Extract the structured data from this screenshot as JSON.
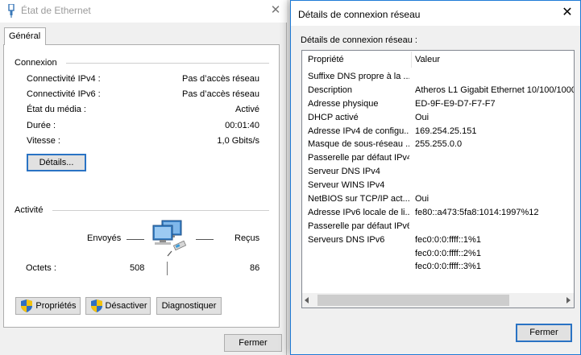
{
  "etat_window": {
    "title": "État de Ethernet",
    "tab": "Général",
    "connexion": {
      "title": "Connexion",
      "rows": [
        {
          "label": "Connectivité IPv4 :",
          "value": "Pas d’accès réseau"
        },
        {
          "label": "Connectivité IPv6 :",
          "value": "Pas d’accès réseau"
        },
        {
          "label": "État du média :",
          "value": "Activé"
        },
        {
          "label": "Durée :",
          "value": "00:01:40"
        },
        {
          "label": "Vitesse :",
          "value": "1,0 Gbits/s"
        }
      ],
      "details_button": "Détails..."
    },
    "activite": {
      "title": "Activité",
      "sent_label": "Envoyés",
      "received_label": "Reçus",
      "octets_label": "Octets :",
      "sent_value": "508",
      "received_value": "86"
    },
    "buttons": {
      "proprietes": "Propriétés",
      "desactiver": "Désactiver",
      "diagnostiquer": "Diagnostiquer",
      "fermer": "Fermer"
    }
  },
  "details_window": {
    "title": "Détails de connexion réseau",
    "caption": "Détails de connexion réseau :",
    "columns": {
      "property": "Propriété",
      "value": "Valeur"
    },
    "rows": [
      {
        "property": "Suffixe DNS propre à la ...",
        "value": ""
      },
      {
        "property": "Description",
        "value": "Atheros L1 Gigabit Ethernet 10/100/1000"
      },
      {
        "property": "Adresse physique",
        "value": "ED-9F-E9-D7-F7-F7"
      },
      {
        "property": "DHCP activé",
        "value": "Oui"
      },
      {
        "property": "Adresse IPv4 de configu...",
        "value": "169.254.25.151"
      },
      {
        "property": "Masque de sous-réseau ...",
        "value": "255.255.0.0"
      },
      {
        "property": "Passerelle par défaut IPv4",
        "value": ""
      },
      {
        "property": "Serveur DNS IPv4",
        "value": ""
      },
      {
        "property": "Serveur WINS IPv4",
        "value": ""
      },
      {
        "property": "NetBIOS sur TCP/IP act...",
        "value": "Oui"
      },
      {
        "property": "Adresse IPv6 locale de li...",
        "value": "fe80::a473:5fa8:1014:1997%12"
      },
      {
        "property": "Passerelle par défaut IPv6",
        "value": ""
      },
      {
        "property": "Serveurs DNS IPv6",
        "value": "fec0:0:0:ffff::1%1"
      },
      {
        "property": "",
        "value": "fec0:0:0:ffff::2%1"
      },
      {
        "property": "",
        "value": "fec0:0:0:ffff::3%1"
      }
    ],
    "close_button": "Fermer"
  },
  "colors": {
    "accent": "#2a73c4",
    "titlebar": "#ffffff",
    "face": "#f0f0f0"
  }
}
